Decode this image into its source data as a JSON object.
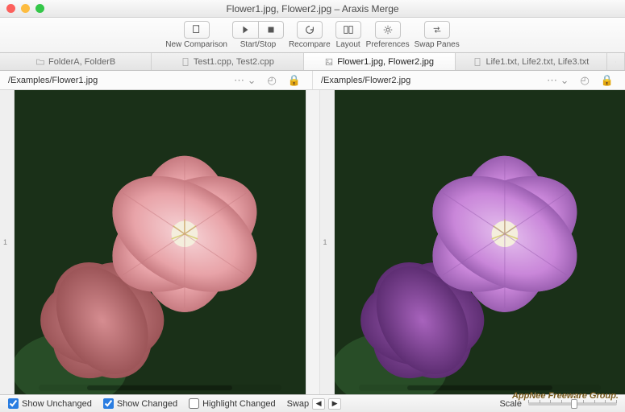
{
  "window": {
    "title": "Flower1.jpg, Flower2.jpg – Araxis Merge"
  },
  "toolbar": {
    "new_comparison": "New Comparison",
    "start_stop": "Start/Stop",
    "recompare": "Recompare",
    "layout": "Layout",
    "preferences": "Preferences",
    "swap_panes": "Swap Panes"
  },
  "tabs": [
    {
      "label": "FolderA, FolderB",
      "icon": "folder-icon",
      "active": false
    },
    {
      "label": "Test1.cpp, Test2.cpp",
      "icon": "file-icon",
      "active": false
    },
    {
      "label": "Flower1.jpg, Flower2.jpg",
      "icon": "image-file-icon",
      "active": true
    },
    {
      "label": "Life1.txt, Life2.txt, Life3.txt",
      "icon": "file-icon",
      "active": false
    }
  ],
  "paths": {
    "left": "/Examples/Flower1.jpg",
    "right": "/Examples/Flower2.jpg"
  },
  "bottom": {
    "show_unchanged": "Show Unchanged",
    "show_changed": "Show Changed",
    "highlight_changed": "Highlight Changed",
    "swap_label": "Swap",
    "scale_label": "Scale"
  },
  "checks": {
    "show_unchanged": true,
    "show_changed": true,
    "highlight_changed": false
  },
  "colors": {
    "left_flower_primary": "#e8a3a8",
    "left_flower_dark": "#b56b6f",
    "right_flower_primary": "#c986d9",
    "right_flower_dark": "#7e4596",
    "leaf": "#2f5a2d"
  },
  "watermark": "AppNee Freeware Group."
}
